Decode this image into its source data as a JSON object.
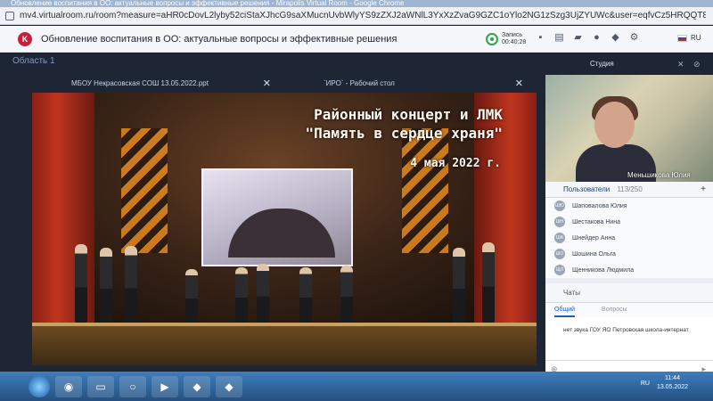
{
  "browser": {
    "window_title": "Обновление воспитания в ОО: актуальные вопросы и эффективные решения - Mirapolis Virtual Room - Google Chrome",
    "url": "mv4.virtualroom.ru/room?measure=aHR0cDovL2lyby52ciStaXJhcG9saXMucnUvbWlyYS9zZXJ2aWNlL3YxXzZvaG9GZC1oYlo2NG1zSzg3UjZYUWc&user=eqfvCz5HRQQT8EWIejRwiQ"
  },
  "header": {
    "logo": "K",
    "meeting_title": "Обновление воспитания в ОО: актуальные вопросы и эффективные решения",
    "record_label": "Запись",
    "record_time": "00:40:28",
    "icons": [
      "chat-bubble-icon",
      "document-icon",
      "folder-icon",
      "user-icon",
      "users-icon",
      "settings-icon",
      "flag-ru-icon"
    ],
    "language": "RU"
  },
  "workspace": {
    "area_label": "Область 1",
    "tabs": [
      {
        "label": "МБОУ Некрасовская СОШ 13.05.2022.ppt"
      },
      {
        "label": "`ИРО` - Рабочий стол"
      }
    ],
    "slide": {
      "title_line1": "Районный концерт и ЛМК",
      "title_line2": "\"Память в сердце храня\"",
      "date": "4 мая 2022 г."
    }
  },
  "side": {
    "studio_label": "Студия",
    "speaker_name": "Меньшикова Юлия",
    "users_title": "Пользователи",
    "users_count": "113/250",
    "users": [
      {
        "initials": "ШЮ",
        "name": "Шаповалова Юлия"
      },
      {
        "initials": "ШН",
        "name": "Шестакова Нина"
      },
      {
        "initials": "ША",
        "name": "Шнейдер Анна"
      },
      {
        "initials": "ШО",
        "name": "Шошина Ольга"
      },
      {
        "initials": "ЩЛ",
        "name": "Щенникова Людмила"
      }
    ],
    "chat_title": "Чаты",
    "chat_tabs": {
      "general": "Общий",
      "questions": "Вопросы"
    },
    "chat_message": "нет звука ГОУ ЯО Петровская школа-интернат"
  },
  "taskbar": {
    "language": "RU",
    "time": "11:44",
    "date": "13.05.2022"
  },
  "colors": {
    "accent": "#1f5fb5",
    "record": "#2ea84a",
    "logo": "#c8203b"
  }
}
